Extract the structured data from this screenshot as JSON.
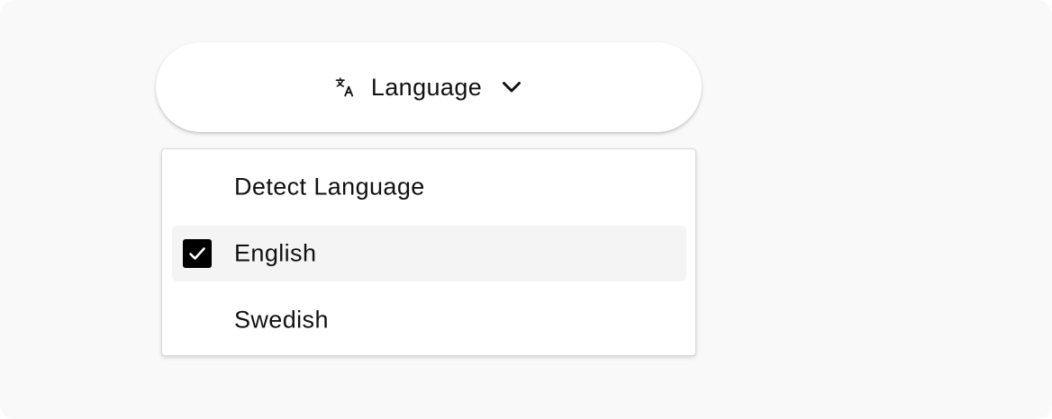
{
  "language_button": {
    "label": "Language",
    "icon": "translate-icon",
    "chevron": "chevron-down-icon"
  },
  "dropdown": {
    "options": [
      {
        "label": "Detect Language",
        "selected": false
      },
      {
        "label": "English",
        "selected": true
      },
      {
        "label": "Swedish",
        "selected": false
      }
    ]
  },
  "colors": {
    "background": "#f9f9f9",
    "surface": "#ffffff",
    "selected_row": "#f4f4f4",
    "checkbox": "#000000",
    "text": "#111111"
  }
}
